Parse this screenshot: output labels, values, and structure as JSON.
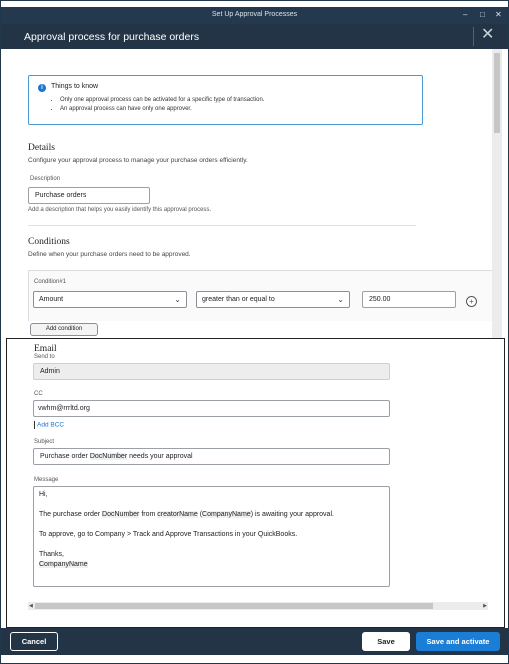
{
  "window": {
    "title": "Set Up Approval Processes",
    "controls": {
      "minimize": "–",
      "maximize": "□",
      "close": "✕"
    }
  },
  "header": {
    "title": "Approval process for purchase orders",
    "close_icon": "✕"
  },
  "info": {
    "heading": "Things to know",
    "bullets": [
      "Only one approval process can be activated for a specific type of transaction.",
      "An approval process can have only one approver."
    ]
  },
  "details": {
    "title": "Details",
    "desc": "Configure your approval process to manage your purchase orders efficiently.",
    "description_label": "Description",
    "description_value": "Purchase orders",
    "description_hint": "Add a description that helps you easily identify this approval process."
  },
  "conditions": {
    "title": "Conditions",
    "desc": "Define when your purchase orders need to be approved.",
    "condition_label": "Condition#1",
    "field_value": "Amount",
    "operator_value": "greater than or equal to",
    "amount_value": "250.00",
    "add_condition_label": "Add condition"
  },
  "email": {
    "title": "Email",
    "send_to_label": "Send to",
    "send_to_value": "Admin",
    "cc_label": "CC",
    "cc_value": "vwhm@rrrltd.org",
    "add_bcc_label": "Add BCC",
    "subject_label": "Subject",
    "subject_parts": [
      "Purchase order ",
      "DocNumber",
      " needs your approval"
    ],
    "message_label": "Message",
    "message": {
      "greeting": "Hi,",
      "line1": [
        "The purchase order ",
        "DocNumber",
        " from ",
        "creatorName",
        " (",
        "CompanyName",
        ") is awaiting your approval."
      ],
      "line2": "To approve, go to Company > Track and Approve Transactions in your QuickBooks.",
      "thanks": "Thanks,",
      "signature": "CompanyName"
    }
  },
  "footer": {
    "cancel_label": "Cancel",
    "save_label": "Save",
    "save_activate_label": "Save and activate"
  },
  "colors": {
    "header_bg": "#243447",
    "accent_blue": "#1a7dd6",
    "info_border": "#4a9ad8"
  }
}
